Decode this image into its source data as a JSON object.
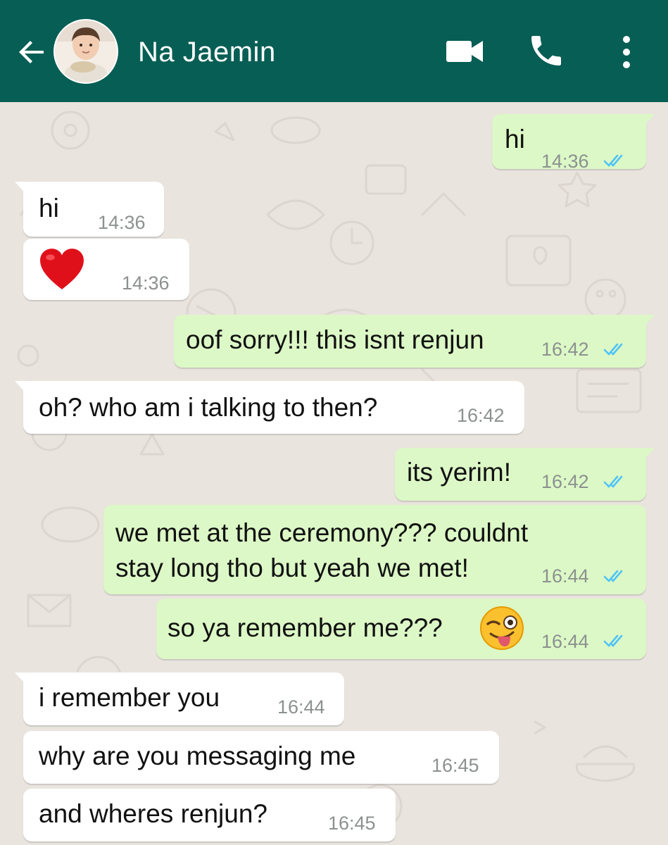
{
  "header": {
    "contact_name": "Na Jaemin",
    "background_color": "#075e54",
    "icons": [
      "back-arrow-icon",
      "video-call-icon",
      "phone-icon",
      "more-vert-icon"
    ]
  },
  "messages": [
    {
      "direction": "out",
      "text": "hi",
      "time": "14:36",
      "status": "read"
    },
    {
      "direction": "in",
      "text": "hi",
      "time": "14:36"
    },
    {
      "direction": "in",
      "text": "",
      "emoji": "red-heart",
      "time": "14:36"
    },
    {
      "direction": "out",
      "text": "oof sorry!!! this isnt renjun",
      "time": "16:42",
      "status": "read"
    },
    {
      "direction": "in",
      "text": "oh? who am i talking to then?",
      "time": "16:42"
    },
    {
      "direction": "out",
      "text": "its yerim!",
      "time": "16:42",
      "status": "read"
    },
    {
      "direction": "out",
      "lines": [
        "we met at the ceremony??? couldnt",
        "stay long tho but yeah we met!"
      ],
      "time": "16:44",
      "status": "read"
    },
    {
      "direction": "out",
      "text": "so ya remember me???",
      "emoji": "winking-face-with-tongue",
      "time": "16:44",
      "status": "read"
    },
    {
      "direction": "in",
      "text": "i remember you",
      "time": "16:44"
    },
    {
      "direction": "in",
      "text": "why are you messaging me",
      "time": "16:45"
    },
    {
      "direction": "in",
      "text": "and wheres renjun?",
      "time": "16:45"
    }
  ],
  "colors": {
    "chat_background": "#e9e4de",
    "incoming_bubble": "#ffffff",
    "outgoing_bubble": "#dcf8c6",
    "read_ticks": "#4fc3f7"
  }
}
